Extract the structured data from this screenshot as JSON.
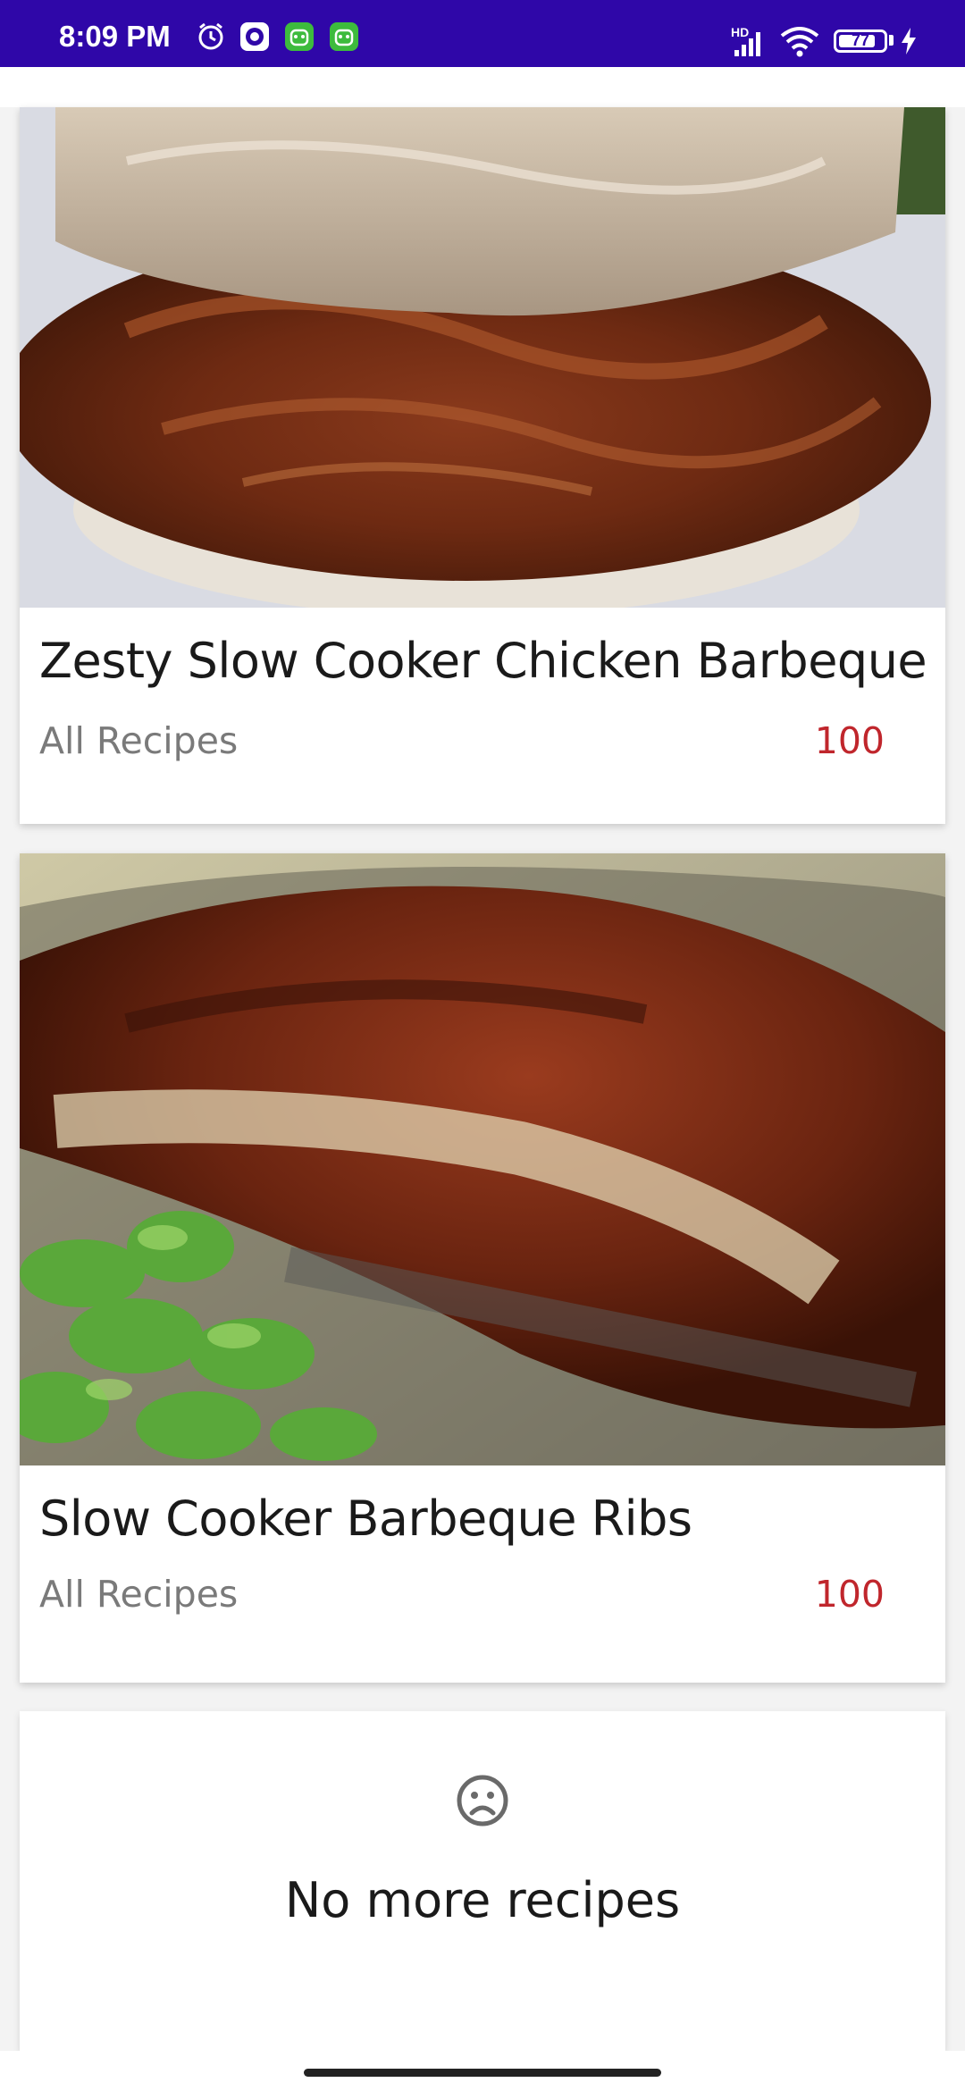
{
  "status_bar": {
    "time": "8:09 PM",
    "network_label": "HD",
    "battery_level": "77",
    "icons": [
      "alarm-icon",
      "app-icon",
      "android-icon",
      "android-icon",
      "signal-icon",
      "wifi-icon",
      "battery-icon",
      "charging-icon"
    ]
  },
  "recipes": [
    {
      "title": "Zesty Slow Cooker Chicken Barbeque",
      "source": "All Recipes",
      "score": "100"
    },
    {
      "title": "Slow Cooker Barbeque Ribs",
      "source": "All Recipes",
      "score": "100"
    }
  ],
  "empty_state": {
    "icon": "sad-face-icon",
    "message": "No more recipes"
  },
  "colors": {
    "status_bar": "#2f07a8",
    "score": "#c0262c",
    "source": "#7a7a7a"
  }
}
